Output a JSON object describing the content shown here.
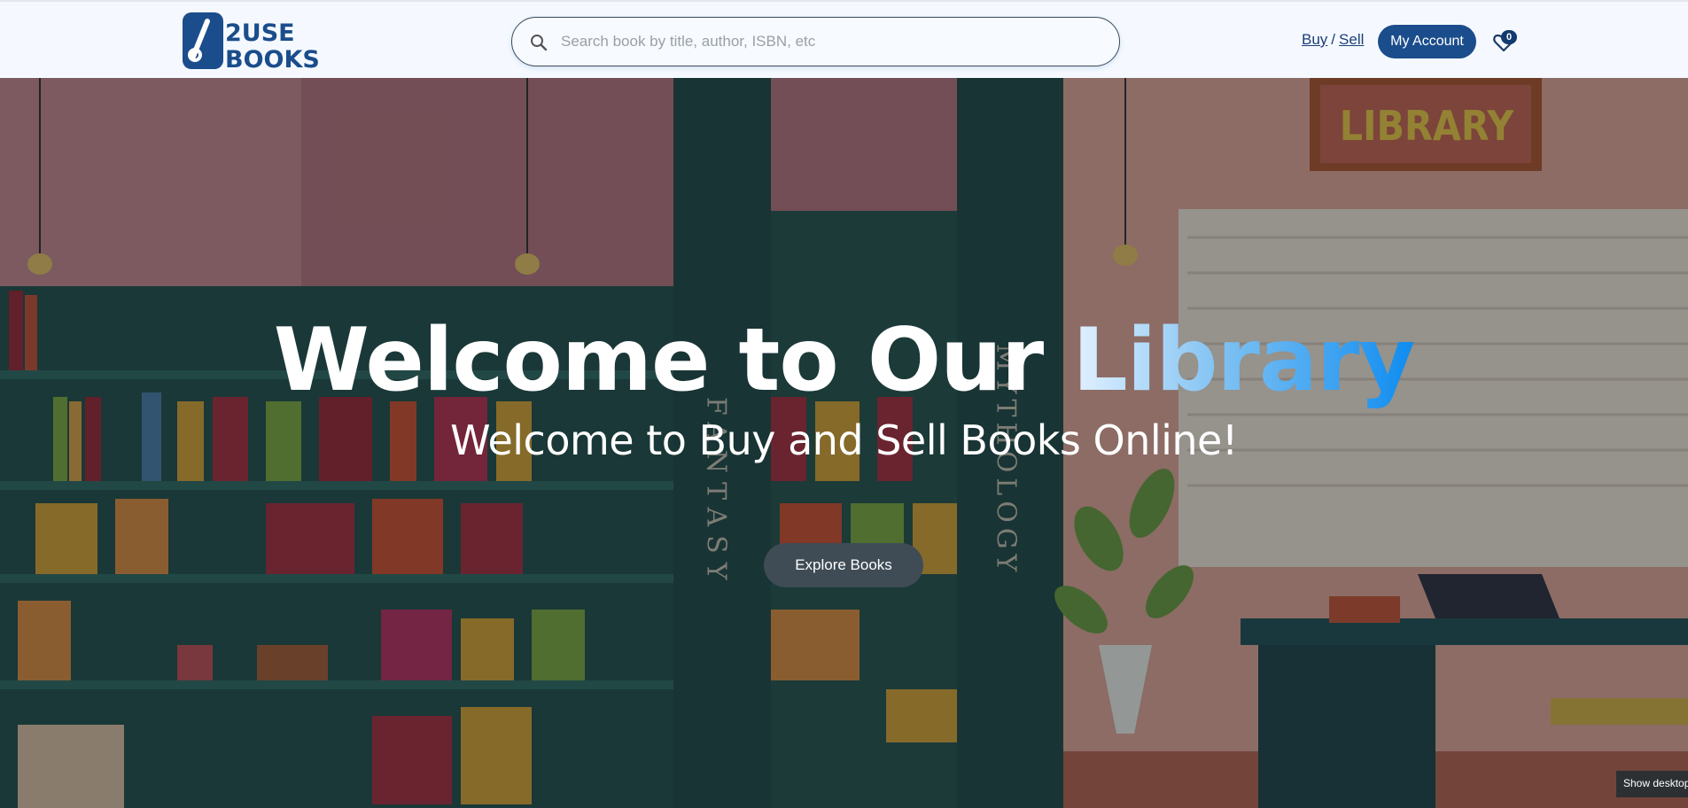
{
  "header": {
    "logo_top": "2USE",
    "logo_bottom": "BOOKS",
    "search_placeholder": "Search book by title, author, ISBN, etc",
    "buy_label": "Buy",
    "separator": "/",
    "sell_label": "Sell",
    "account_label": "My Account",
    "cart_count": "0"
  },
  "hero": {
    "title_main": "Welcome to Our ",
    "title_accent": "Library",
    "subtitle": "Welcome to Buy and Sell Books Online!",
    "button_label": "Explore Books",
    "sign_text": "LIBRARY",
    "pillar_left": "FANTASY",
    "pillar_right": "MYTHOLOGY"
  },
  "toast": {
    "label": "Show desktop"
  },
  "colors": {
    "brand": "#1b4d8c",
    "accent_start": "#e3f1ff",
    "accent_end": "#0e8cf0"
  }
}
